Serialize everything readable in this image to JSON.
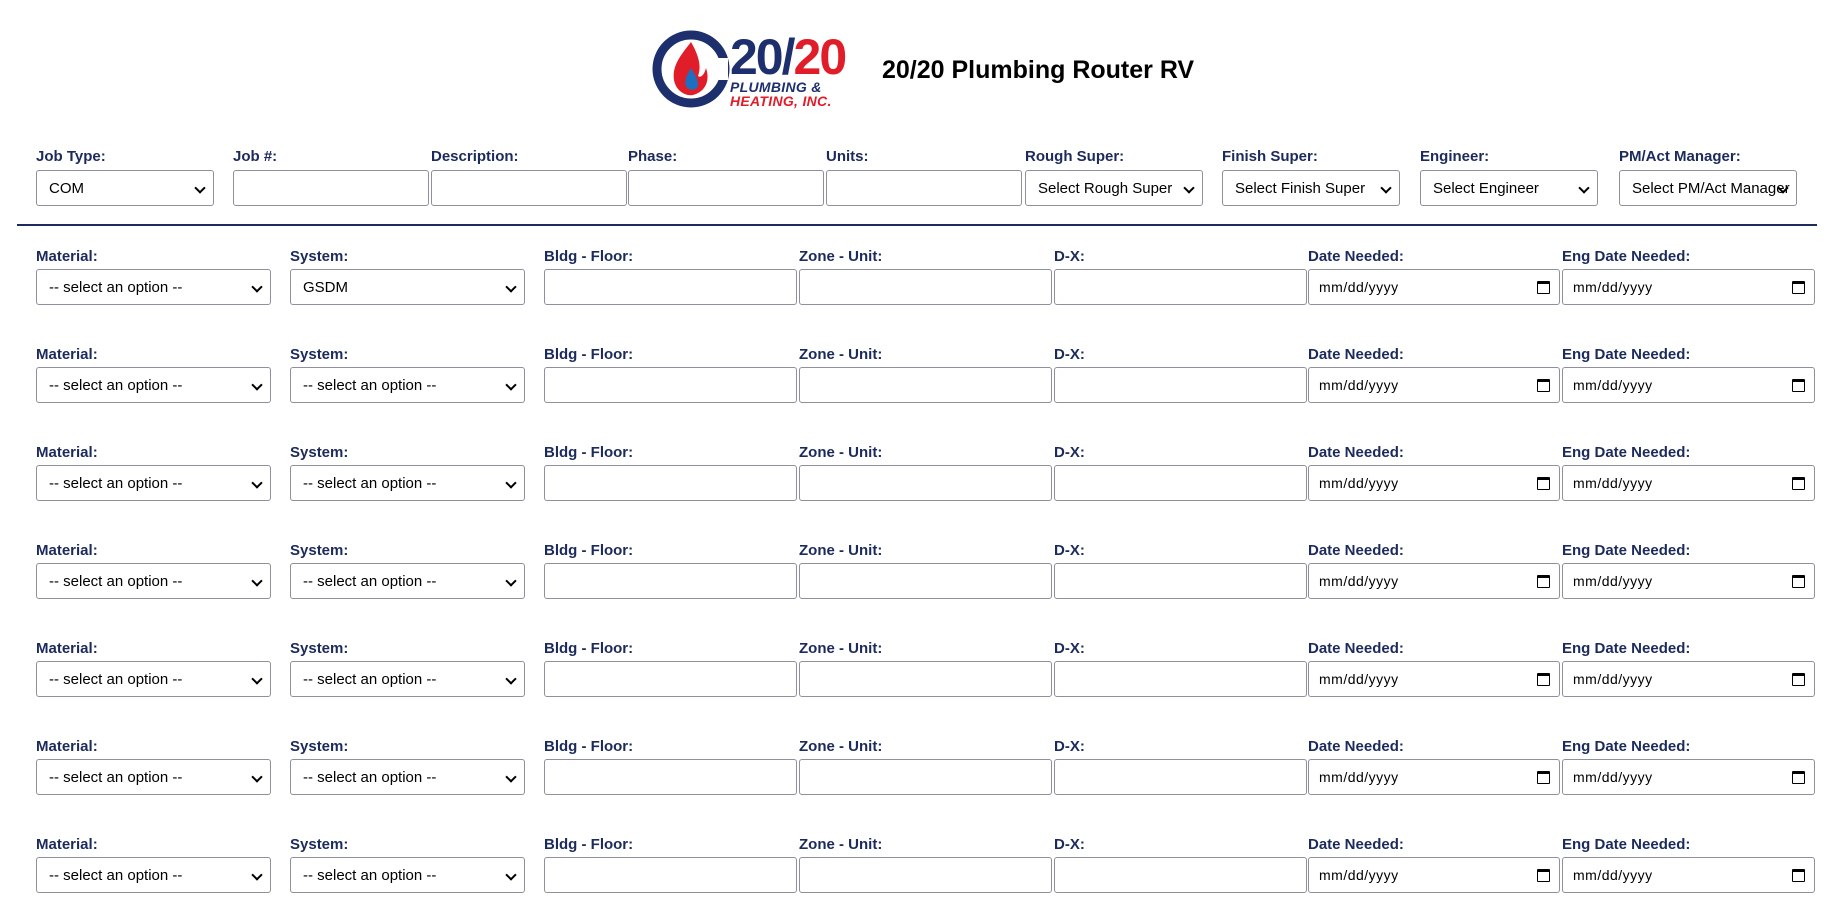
{
  "header": {
    "logo_big_left": "20/",
    "logo_big_right": "20",
    "logo_line1": "PLUMBING &",
    "logo_line2": "HEATING, INC.",
    "title": "20/20 Plumbing Router RV"
  },
  "colors": {
    "navy": "#1c2a5c",
    "logo_blue": "#1e2f6e",
    "logo_red": "#e11d2a"
  },
  "top_fields": [
    {
      "label": "Job Type:",
      "kind": "select",
      "value": "COM"
    },
    {
      "label": "Job #:",
      "kind": "input",
      "value": ""
    },
    {
      "label": "Description:",
      "kind": "input",
      "value": ""
    },
    {
      "label": "Phase:",
      "kind": "input",
      "value": ""
    },
    {
      "label": "Units:",
      "kind": "input",
      "value": ""
    },
    {
      "label": "Rough Super:",
      "kind": "select",
      "value": "Select Rough Super"
    },
    {
      "label": "Finish Super:",
      "kind": "select",
      "value": "Select Finish Super"
    },
    {
      "label": "Engineer:",
      "kind": "select",
      "value": "Select Engineer"
    },
    {
      "label": "PM/Act Manager:",
      "kind": "select",
      "value": "Select PM/Act Manager"
    }
  ],
  "material_labels": {
    "material": "Material:",
    "system": "System:",
    "bldg_floor": "Bldg - Floor:",
    "zone_unit": "Zone - Unit:",
    "dx": "D-X:",
    "date_needed": "Date Needed:",
    "eng_date_needed": "Eng Date Needed:"
  },
  "date_placeholder": "mm/dd/yyyy",
  "material_rows": [
    {
      "material": "-- select an option --",
      "system": "GSDM"
    },
    {
      "material": "-- select an option --",
      "system": "-- select an option --"
    },
    {
      "material": "-- select an option --",
      "system": "-- select an option --"
    },
    {
      "material": "-- select an option --",
      "system": "-- select an option --"
    },
    {
      "material": "-- select an option --",
      "system": "-- select an option --"
    },
    {
      "material": "-- select an option --",
      "system": "-- select an option --"
    },
    {
      "material": "-- select an option --",
      "system": "-- select an option --"
    }
  ]
}
